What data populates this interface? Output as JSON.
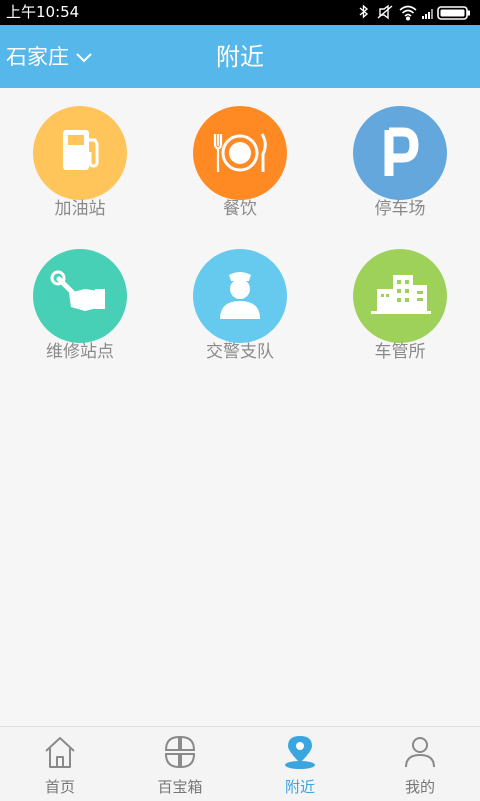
{
  "status_bar": {
    "time": "上午10:54",
    "icons": [
      "bluetooth-icon",
      "mute-icon",
      "wifi-icon",
      "signal-icon",
      "battery-icon"
    ]
  },
  "header": {
    "city": "石家庄",
    "title": "附近",
    "background_color": "#56b8ea"
  },
  "grid": {
    "items": [
      {
        "label": "加油站",
        "icon": "gas-station-icon",
        "color": "#ffc45a"
      },
      {
        "label": "餐饮",
        "icon": "dining-icon",
        "color": "#ff8a24"
      },
      {
        "label": "停车场",
        "icon": "parking-icon",
        "color": "#63a7dc"
      },
      {
        "label": "维修站点",
        "icon": "repair-icon",
        "color": "#47d0b5"
      },
      {
        "label": "交警支队",
        "icon": "traffic-police-icon",
        "color": "#66c9ee"
      },
      {
        "label": "车管所",
        "icon": "vehicle-office-icon",
        "color": "#9ed15a"
      }
    ]
  },
  "tabbar": {
    "active_color": "#3aa6e0",
    "tabs": [
      {
        "label": "首页",
        "icon": "home-icon",
        "active": false
      },
      {
        "label": "百宝箱",
        "icon": "toolbox-icon",
        "active": false
      },
      {
        "label": "附近",
        "icon": "nearby-location-icon",
        "active": true
      },
      {
        "label": "我的",
        "icon": "profile-icon",
        "active": false
      }
    ]
  }
}
